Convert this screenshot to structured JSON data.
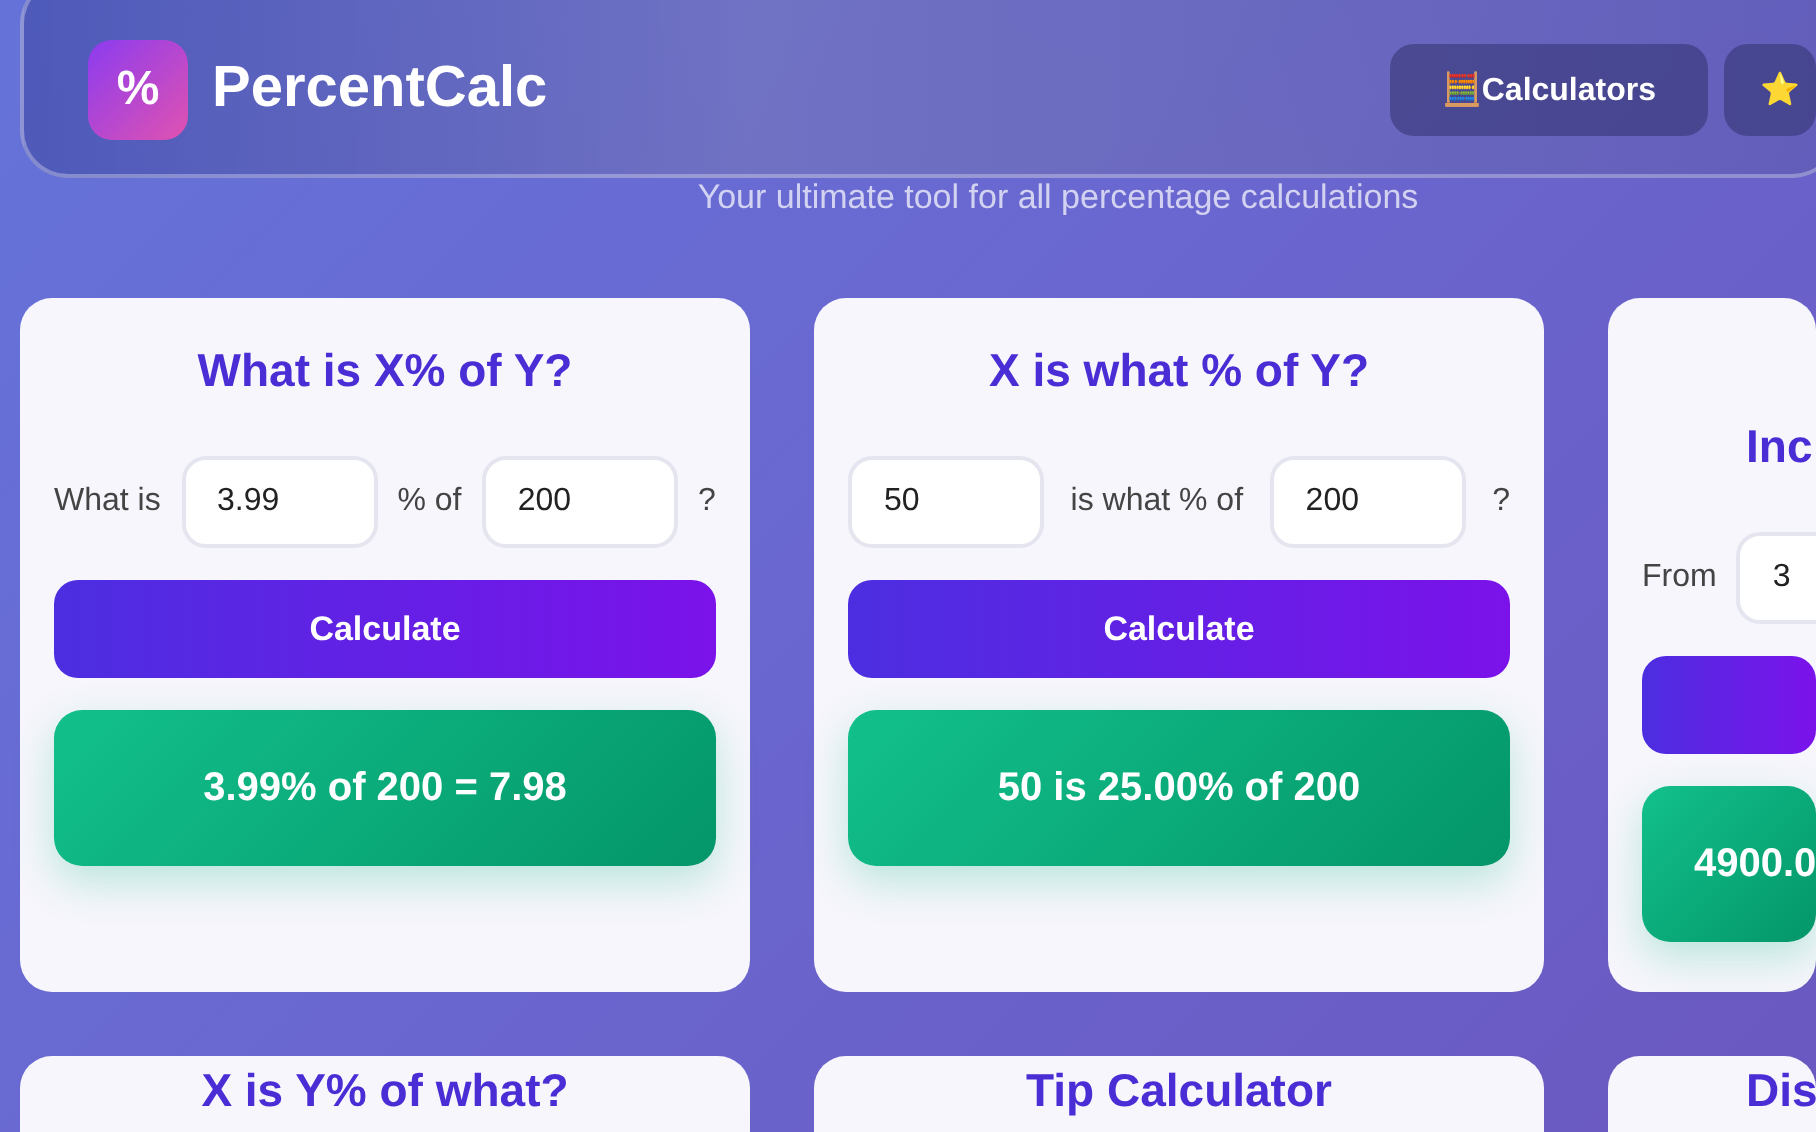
{
  "header": {
    "logo": "%",
    "brand": "PercentCalc",
    "nav": [
      {
        "icon": "🧮",
        "label": "Calculators"
      },
      {
        "icon": "⭐"
      }
    ]
  },
  "subtitle": "Your ultimate tool for all percentage calculations",
  "calculators": [
    {
      "title": "What is X% of Y?",
      "row": [
        {
          "kind": "label",
          "text": "What is"
        },
        {
          "kind": "input",
          "value": "3.99"
        },
        {
          "kind": "label",
          "text": "% of"
        },
        {
          "kind": "input",
          "value": "200"
        },
        {
          "kind": "label",
          "text": "?"
        }
      ],
      "button": "Calculate",
      "result": "3.99% of 200 = 7.98"
    },
    {
      "title": "X is what % of Y?",
      "row": [
        {
          "kind": "input",
          "value": "50"
        },
        {
          "kind": "label",
          "text": "is what % of"
        },
        {
          "kind": "input",
          "value": "200"
        },
        {
          "kind": "label",
          "text": "?"
        }
      ],
      "button": "Calculate",
      "result": "50 is 25.00% of 200"
    },
    {
      "title": "Inc",
      "row": [
        {
          "kind": "label",
          "text": "From"
        },
        {
          "kind": "input",
          "value": "3"
        }
      ],
      "result": "4900.0"
    }
  ],
  "more_calculators": [
    {
      "title": "X is Y% of what?"
    },
    {
      "title": "Tip Calculator"
    },
    {
      "title": "Dis"
    }
  ]
}
